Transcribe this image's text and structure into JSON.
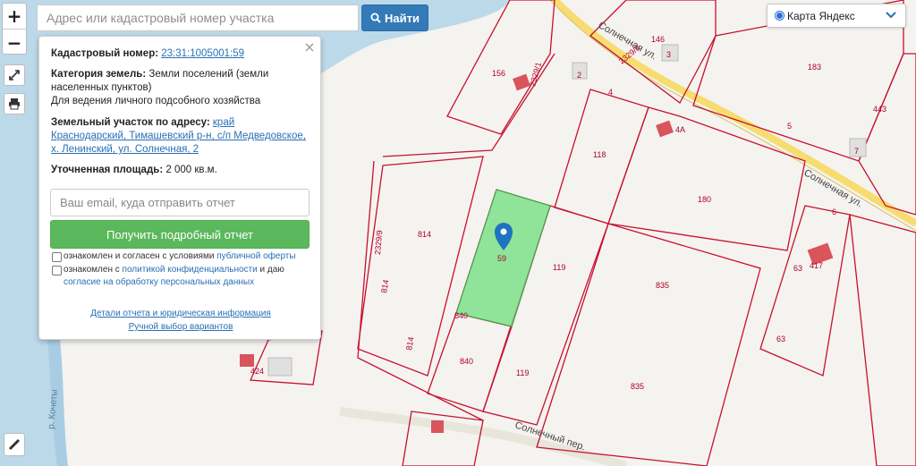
{
  "search": {
    "placeholder": "Адрес или кадастровый номер участка",
    "button_label": "Найти"
  },
  "toolbar": {
    "zoom_in": "+",
    "zoom_out": "−"
  },
  "map_type": {
    "selected": "Карта Яндекс"
  },
  "popup": {
    "cadastral_label": "Кадастровый номер:",
    "cadastral_value": "23:31:1005001:59",
    "category_label": "Категория земель:",
    "category_value": "Земли поселений (земли населенных пунктов)",
    "category_use": "Для ведения личного подсобного хозяйства",
    "address_label": "Земельный участок по адресу:",
    "address_value": "край Краснодарский, Тимашевский р-н, с/п Медведовское, х. Ленинский, ул. Солнечная, 2",
    "area_label": "Уточненная площадь:",
    "area_value": "2 000 кв.м.",
    "email_placeholder": "Ваш email, куда отправить отчет",
    "report_button": "Получить подробный отчет",
    "consent1_text": "ознакомлен и согласен с условиями",
    "consent1_link": "публичной оферты",
    "consent2_text": "ознакомлен с",
    "consent2_link": "политикой конфиденциальности",
    "consent2_rest": "и даю",
    "consent2_link2": "согласие на обработку персональных данных",
    "details_link": "Детали отчета и юридическая информация",
    "manual_link": "Ручной выбор вариантов"
  },
  "map": {
    "parcel_labels": [
      "156",
      "146",
      "3",
      "2",
      "4",
      "183",
      "443",
      "5",
      "7",
      "4А",
      "118",
      "180",
      "814",
      "814",
      "814",
      "59",
      "119",
      "835",
      "840",
      "840",
      "119",
      "835",
      "63",
      "63",
      "417",
      "424",
      "6"
    ],
    "street_labels": [
      "Солнечная ул.",
      "Солнечная ул.",
      "Солнечный пер."
    ],
    "road_codes": [
      "2329/8",
      "2329/9",
      "2329/1"
    ],
    "river_label": "р. Кочеты"
  },
  "colors": {
    "parcel_border": "#c8102e",
    "selected_parcel": "#7ee08a",
    "water": "#bcd9ea",
    "road": "#f7dc6f",
    "accent": "#337ab7",
    "report_button": "#5cb85c"
  }
}
